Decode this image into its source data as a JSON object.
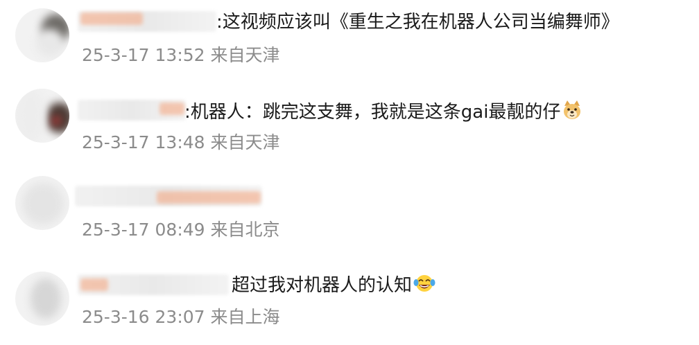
{
  "comments": [
    {
      "text": ":这视频应该叫《重生之我在机器人公司当编舞师》",
      "time": "25-3-17 13:52",
      "location": "来自天津",
      "emoji": ""
    },
    {
      "text": ":机器人：跳完这支舞，我就是这条gai最靓的仔",
      "time": "25-3-17 13:48",
      "location": "来自天津",
      "emoji": "dog-face-icon"
    },
    {
      "text": "",
      "time": "25-3-17 08:49",
      "location": "来自北京",
      "emoji": ""
    },
    {
      "text": "超过我对机器人的认知",
      "time": "25-3-16 23:07",
      "location": "来自上海",
      "emoji": "laughing-tears-icon"
    }
  ],
  "colors": {
    "text": "#1a1a1a",
    "meta": "#8b8b8b",
    "username_tint": "#f29b6b"
  }
}
